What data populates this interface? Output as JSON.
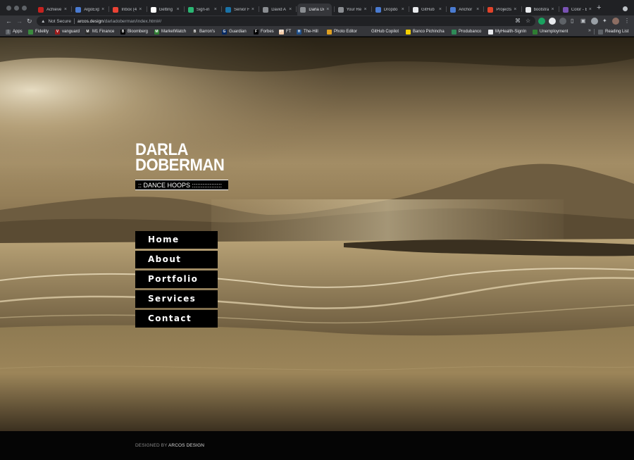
{
  "browser": {
    "tabs": [
      {
        "title": "Achieve",
        "color": "#c5221f"
      },
      {
        "title": "AlgoExp",
        "color": "#4a7bd1"
      },
      {
        "title": "Inbox (4",
        "color": "#ea4335"
      },
      {
        "title": "Getting",
        "color": "#ffffff"
      },
      {
        "title": "Sign-in",
        "color": "#2bb673"
      },
      {
        "title": "Senior F",
        "color": "#1a73a8"
      },
      {
        "title": "David A",
        "color": "#8a8d91"
      },
      {
        "title": "Darla Do",
        "color": "#8a8d91"
      },
      {
        "title": "Your Re",
        "color": "#8a8d91"
      },
      {
        "title": "Dropdo",
        "color": "#4a7bd1"
      },
      {
        "title": "GitHub",
        "color": "#e8eaed"
      },
      {
        "title": "Anchor",
        "color": "#4a7bd1"
      },
      {
        "title": "Projects",
        "color": "#e2432a"
      },
      {
        "title": "bootstra",
        "color": "#e8eaed"
      },
      {
        "title": "Color - B",
        "color": "#7952b3"
      }
    ],
    "active_tab": "Darla Do",
    "security": "Not Secure",
    "url_host": "arcos.design",
    "url_path": "/darladoberman/index.html#/",
    "bookmarks": [
      {
        "label": "Apps",
        "icon": "apps-grid-icon",
        "glyph": "⋮",
        "color": "#5f6368"
      },
      {
        "label": "Fidelity",
        "icon": "fidelity-icon",
        "glyph": "",
        "color": "#3b8a3e"
      },
      {
        "label": "vanguard",
        "icon": "vanguard-icon",
        "glyph": "V",
        "color": "#9c1c1c"
      },
      {
        "label": "M1 Finance",
        "icon": "m1-finance-icon",
        "glyph": "M",
        "color": "#2b2b2b"
      },
      {
        "label": "Bloomberg",
        "icon": "bloomberg-icon",
        "glyph": "B",
        "color": "#000000"
      },
      {
        "label": "MarketWatch",
        "icon": "marketwatch-icon",
        "glyph": "M",
        "color": "#2e7d32"
      },
      {
        "label": "Barron's",
        "icon": "barrons-icon",
        "glyph": "B",
        "color": "#3a3a3a"
      },
      {
        "label": "Guardian",
        "icon": "guardian-icon",
        "glyph": "G",
        "color": "#052962"
      },
      {
        "label": "Forbes",
        "icon": "forbes-icon",
        "glyph": "F",
        "color": "#000000"
      },
      {
        "label": "FT",
        "icon": "ft-icon",
        "glyph": "FT",
        "color": "#f2c9a5"
      },
      {
        "label": "The-Hill",
        "icon": "the-hill-icon",
        "glyph": "H",
        "color": "#1d4e89"
      },
      {
        "label": "Photo Editor",
        "icon": "photo-editor-icon",
        "glyph": "",
        "color": "#e0a020"
      },
      {
        "label": "GitHub Copilot",
        "icon": "github-copilot-icon",
        "glyph": "",
        "color": "#35363a"
      },
      {
        "label": "Banco Pichincha",
        "icon": "banco-pichincha-icon",
        "glyph": "",
        "color": "#f4d000"
      },
      {
        "label": "Produbanco",
        "icon": "produbanco-icon",
        "glyph": "",
        "color": "#2e8b57"
      },
      {
        "label": "MyHealth-SignIn",
        "icon": "myhealth-icon",
        "glyph": "",
        "color": "#e8eaed"
      },
      {
        "label": "Unemployment",
        "icon": "unemployment-icon",
        "glyph": "",
        "color": "#2e7d32"
      }
    ],
    "overflow": "»",
    "reading_list": "Reading List"
  },
  "site": {
    "name_line1": "DARLA",
    "name_line2": "DOBERMAN",
    "tagline": ":: DANCE HOOPS :::::::::::::::::",
    "menu": [
      "Home",
      "About",
      "Portfolio",
      "Services",
      "Contact"
    ],
    "credit_prefix": "DESIGNED BY",
    "credit_name": "ARCOS DESIGN"
  }
}
